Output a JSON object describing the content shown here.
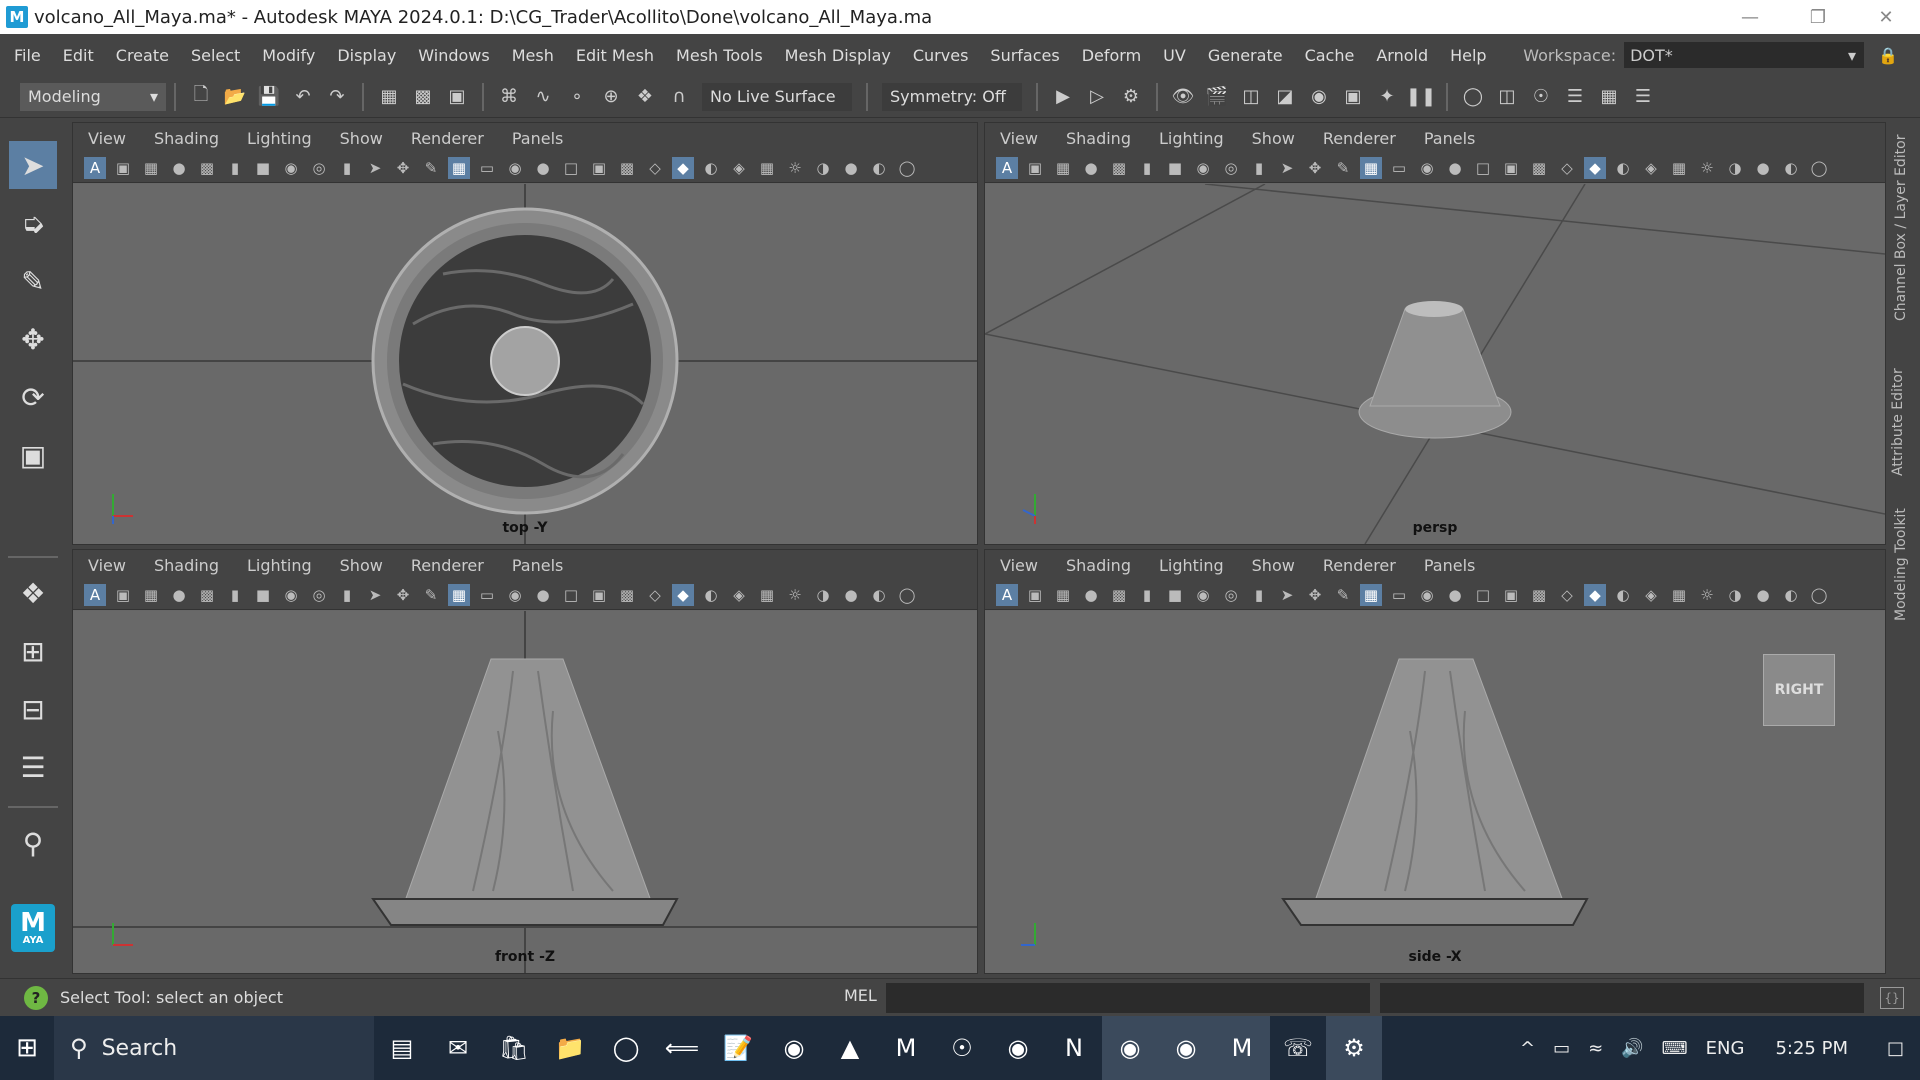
{
  "window": {
    "title": "volcano_All_Maya.ma* - Autodesk MAYA 2024.0.1: D:\\CG_Trader\\Acollito\\Done\\volcano_All_Maya.ma",
    "logo": "M"
  },
  "menu": [
    "File",
    "Edit",
    "Create",
    "Select",
    "Modify",
    "Display",
    "Windows",
    "Mesh",
    "Edit Mesh",
    "Mesh Tools",
    "Mesh Display",
    "Curves",
    "Surfaces",
    "Deform",
    "UV",
    "Generate",
    "Cache",
    "Arnold",
    "Help"
  ],
  "workspace": {
    "label": "Workspace:",
    "value": "DOT*"
  },
  "shelf": {
    "mode": "Modeling",
    "live_surface": "No Live Surface",
    "symmetry": "Symmetry: Off"
  },
  "viewport_menu": [
    "View",
    "Shading",
    "Lighting",
    "Show",
    "Renderer",
    "Panels"
  ],
  "viewports": {
    "top": {
      "camera": "top -Y"
    },
    "persp": {
      "camera": "persp"
    },
    "front": {
      "camera": "front -Z"
    },
    "side": {
      "camera": "side -X",
      "view_cube": "RIGHT"
    }
  },
  "side_tabs": [
    "Channel Box / Layer Editor",
    "Attribute Editor",
    "Modeling Toolkit"
  ],
  "toolbox": {
    "logo_text": "M",
    "logo_sub": "AYA"
  },
  "status": {
    "message": "Select Tool: select an object",
    "mel_label": "MEL"
  },
  "taskbar": {
    "search_placeholder": "Search",
    "lang": "ENG",
    "time": "5:25 PM"
  },
  "colors": {
    "accent": "#5c7fa3",
    "viewport_bg": "#696969",
    "maya_blue": "#1aa0cc"
  }
}
